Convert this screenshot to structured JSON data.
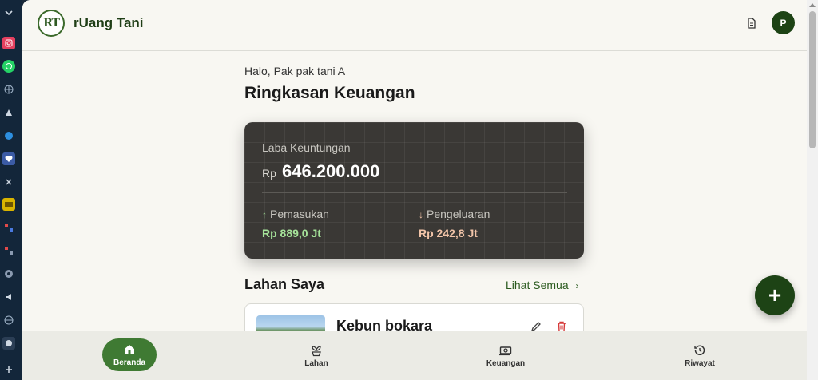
{
  "app": {
    "brand": "rUang Tani",
    "logo_text": "RT",
    "avatar_initial": "P"
  },
  "main": {
    "greeting": "Halo, Pak pak tani A",
    "title": "Ringkasan Keuangan",
    "finance_card": {
      "profit_label": "Laba Keuntungan",
      "currency": "Rp",
      "profit_value": "646.200.000",
      "income_label": "Pemasukan",
      "income_value": "Rp 889,0 Jt",
      "expense_label": "Pengeluaran",
      "expense_value": "Rp 242,8 Jt"
    },
    "lahan_section": {
      "title": "Lahan Saya",
      "see_all": "Lihat Semua",
      "items": [
        {
          "name": "Kebun bokara"
        }
      ]
    }
  },
  "bottom_nav": [
    {
      "label": "Beranda",
      "icon": "home-icon",
      "active": true
    },
    {
      "label": "Lahan",
      "icon": "plant-icon",
      "active": false
    },
    {
      "label": "Keuangan",
      "icon": "money-icon",
      "active": false
    },
    {
      "label": "Riwayat",
      "icon": "history-icon",
      "active": false
    }
  ],
  "colors": {
    "primary": "#1d4315",
    "active_nav": "#3f7a33",
    "card_bg": "#3a3835",
    "income": "#a6e39a",
    "expense": "#f2c4a8",
    "delete": "#d63a3a"
  }
}
